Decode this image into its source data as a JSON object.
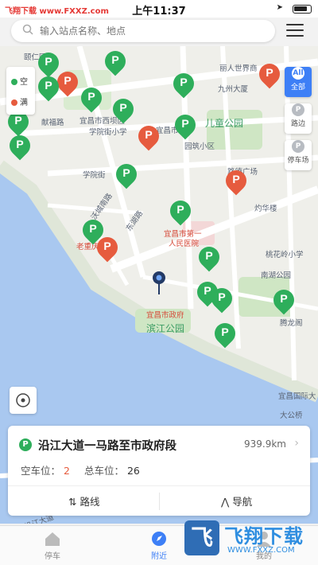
{
  "status_bar": {
    "watermark": "飞翔下载 www.FXXZ.com",
    "time": "上午11:37"
  },
  "search": {
    "placeholder": "输入站点名称、地点"
  },
  "legend": {
    "free_label": "空",
    "full_label": "满",
    "free_color": "#2eae5b",
    "full_color": "#e65b3e"
  },
  "side_buttons": [
    {
      "label": "全部",
      "badge": "All",
      "active": true
    },
    {
      "label": "路边",
      "badge": "P",
      "active": false
    },
    {
      "label": "停车场",
      "badge": "P",
      "active": false
    }
  ],
  "map_labels": {
    "poi_1": "颐仁园",
    "poi_2": "宜昌市西坝区",
    "poi_3": "学院街小学",
    "poi_4": "献福路",
    "poi_5": "园筑小区",
    "poi_6": "儿童公园",
    "poi_7": "丽人世界商",
    "poi_8": "九州大厦",
    "poi_9": "学院街",
    "poi_10": "沃城南路",
    "poi_11": "东湖路",
    "poi_12": "灼华楼",
    "poi_13": "宜昌市第一",
    "poi_14": "人民医院",
    "poi_15": "老重庆",
    "poi_16": "桃花岭小学",
    "poi_17": "南湖公园",
    "poi_18": "宜昌市政府",
    "poi_19": "滨江公园",
    "poi_20": "腾龙阁",
    "poi_21": "宜昌国际大",
    "poi_22": "大公桥",
    "poi_23": "宜昌市政",
    "poi_24": "路德广场",
    "poi_25": "沿江大道"
  },
  "pin_letter": "P",
  "card": {
    "title": "沿江大道一马路至市政府段",
    "distance": "939.9km",
    "free_label": "空车位：",
    "free_value": "2",
    "total_label": "总车位：",
    "total_value": "26",
    "route_label": "路线",
    "nav_label": "导航"
  },
  "tabs": [
    {
      "label": "停车",
      "active": false
    },
    {
      "label": "附近",
      "active": true
    },
    {
      "label": "我的",
      "active": false
    }
  ],
  "footer_watermark": {
    "brand": "飞翔下载",
    "url": "WWW.FXXZ.COM"
  }
}
